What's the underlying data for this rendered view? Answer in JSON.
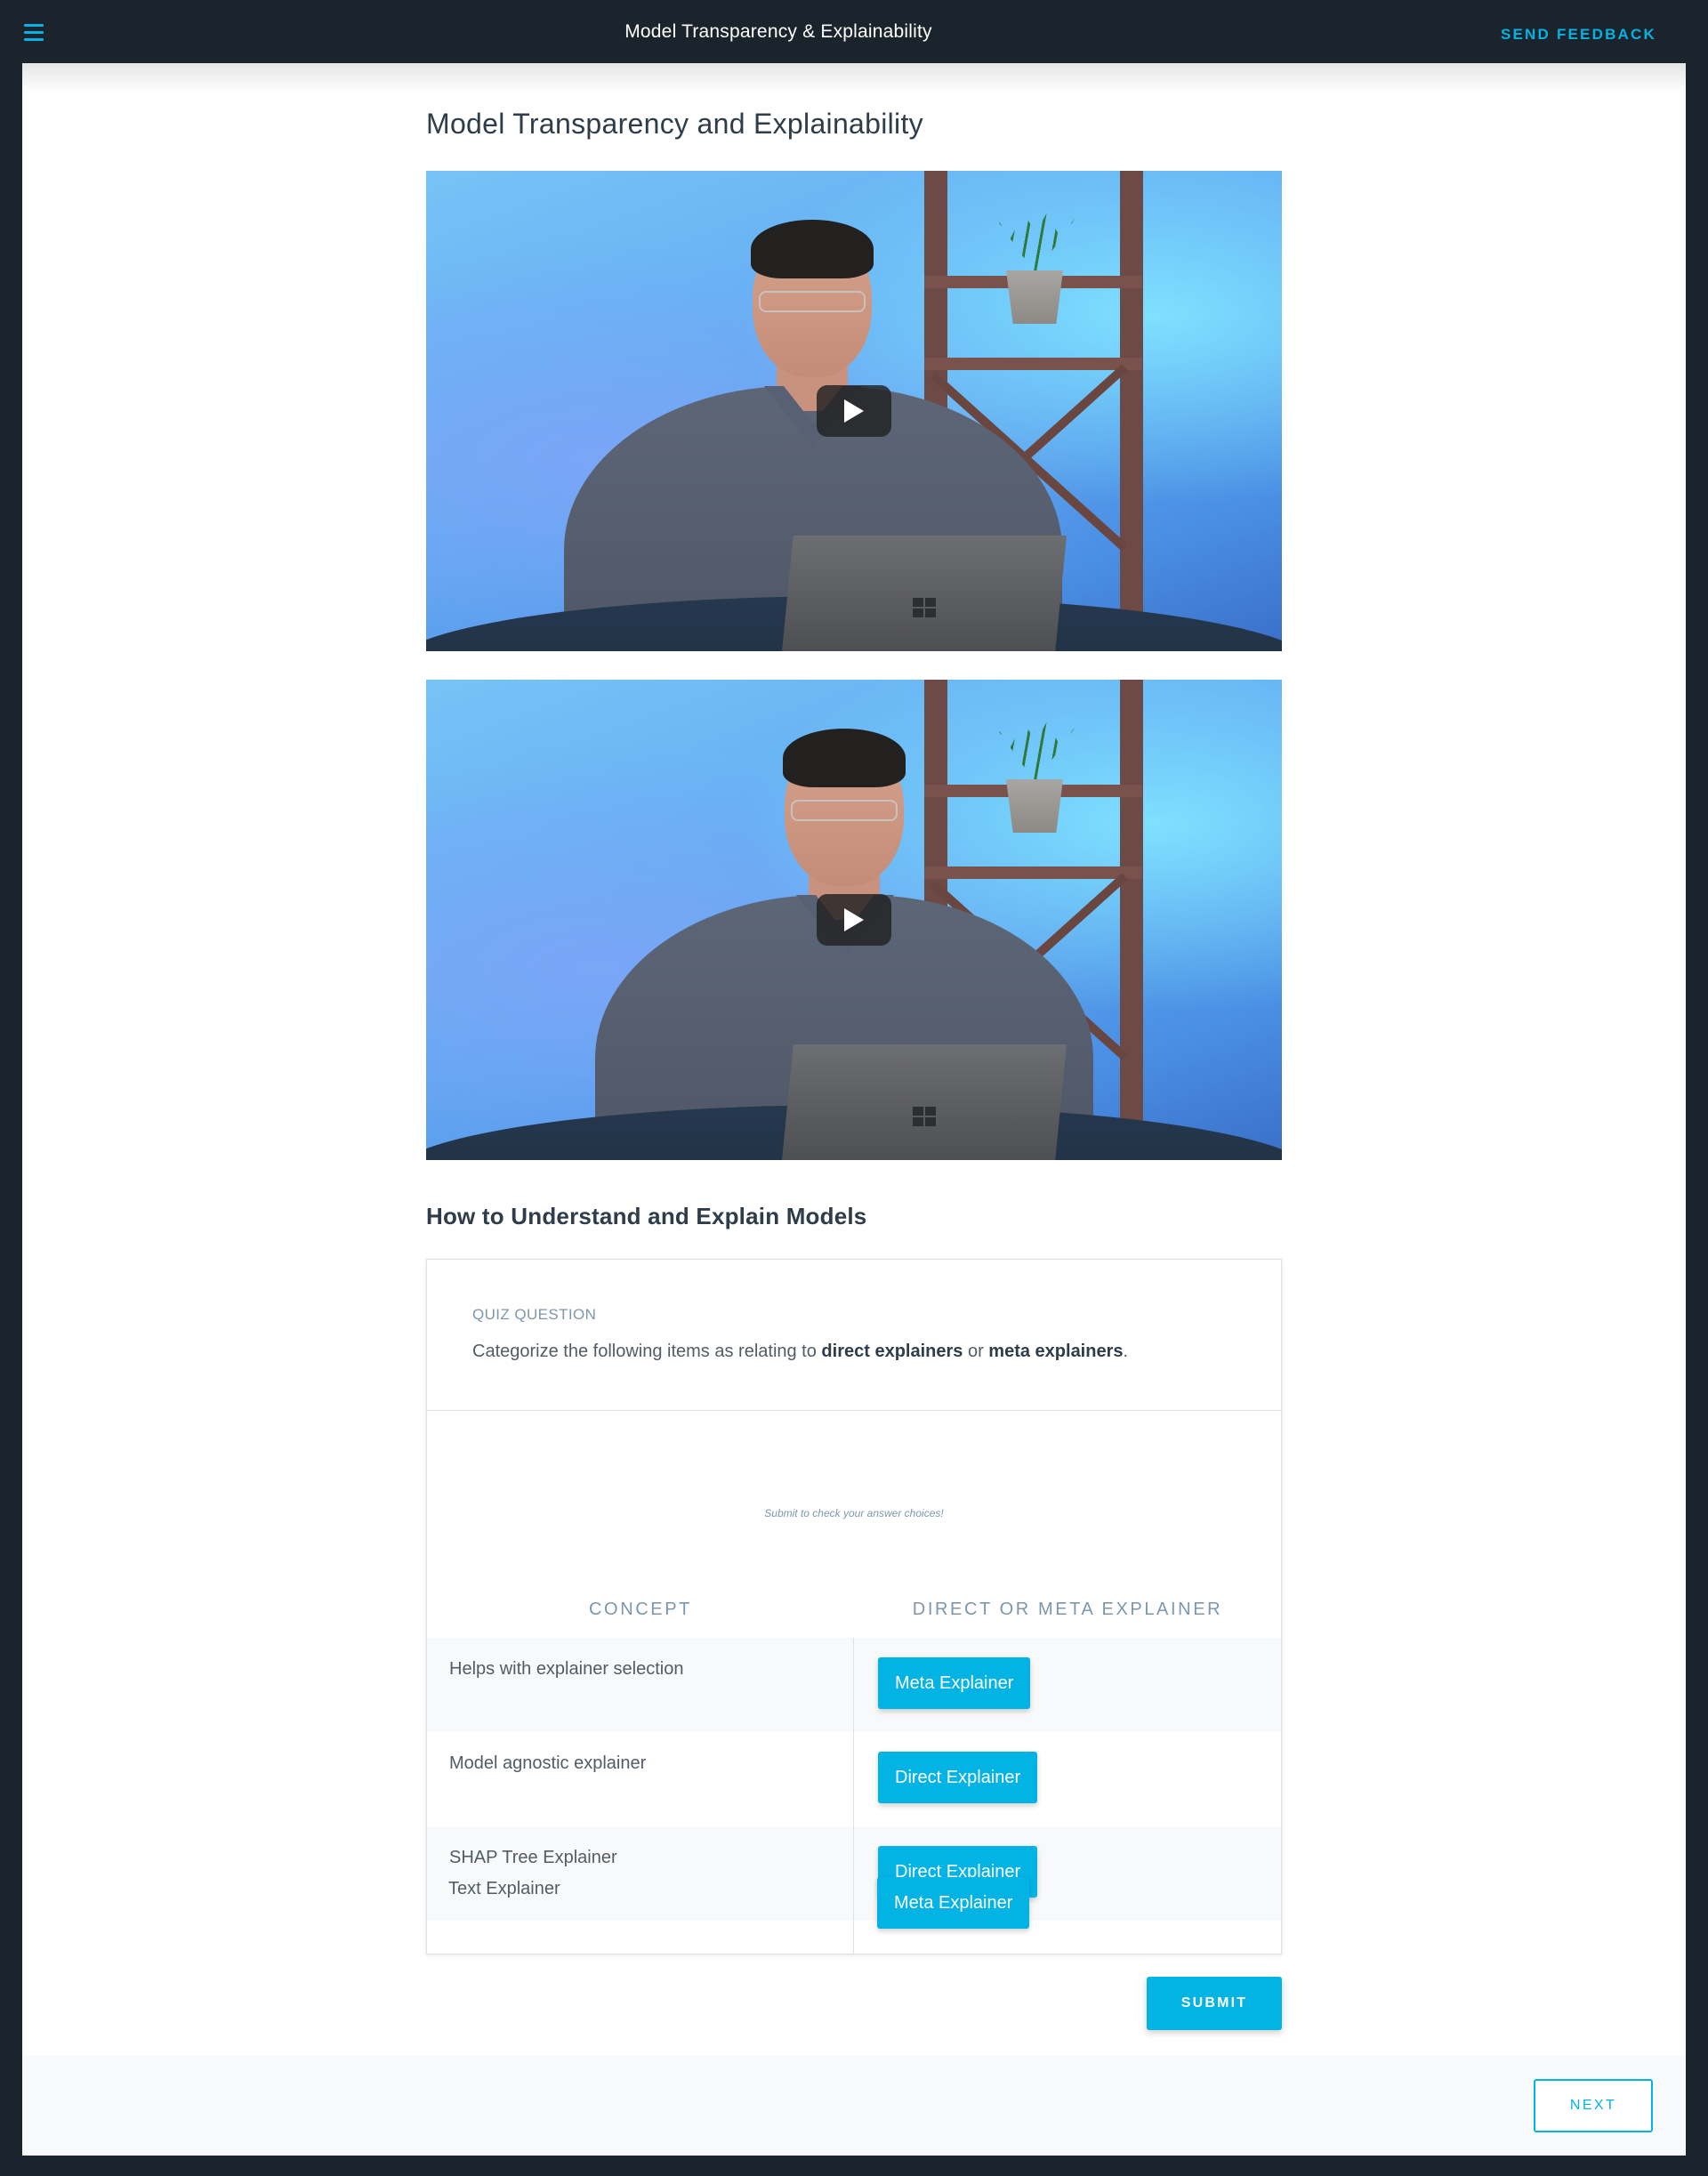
{
  "topbar": {
    "menu_icon": "hamburger-menu-icon",
    "title": "Model Transparency & Explainability",
    "feedback_label": "SEND FEEDBACK"
  },
  "page": {
    "title": "Model Transparency and Explainability",
    "section_heading": "How to Understand and Explain Models"
  },
  "videos": [
    {
      "play_icon": "play-icon"
    },
    {
      "play_icon": "play-icon"
    }
  ],
  "quiz": {
    "label": "QUIZ QUESTION",
    "prompt_before": "Categorize the following items as relating to ",
    "prompt_bold_1": "direct explainers",
    "prompt_middle": " or ",
    "prompt_bold_2": "meta explainers",
    "prompt_after": ".",
    "hint": "Submit to check your answer choices!",
    "column_concept": "CONCEPT",
    "column_answer": "DIRECT OR META EXPLAINER",
    "rows": [
      {
        "concept": "Helps with explainer selection",
        "answer": "Meta Explainer"
      },
      {
        "concept": "Model agnostic explainer",
        "answer": "Direct Explainer"
      },
      {
        "concept": "SHAP Tree Explainer",
        "answer": "Direct Explainer"
      },
      {
        "concept": "Text Explainer",
        "answer": "Meta Explainer"
      }
    ],
    "submit_label": "SUBMIT"
  },
  "footer": {
    "next_label": "NEXT"
  },
  "colors": {
    "accent": "#02b3e4",
    "dark_bar": "#1b242c",
    "heading_text": "#2e3d49",
    "muted_text": "#7d97ad"
  }
}
